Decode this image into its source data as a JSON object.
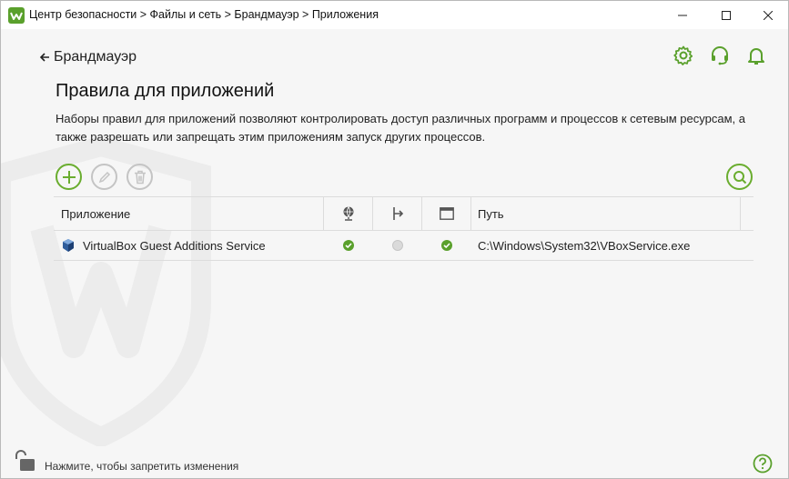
{
  "window": {
    "title": "Центр безопасности > Файлы и сеть > Брандмауэр > Приложения",
    "controls": [
      "minimize",
      "maximize",
      "close"
    ]
  },
  "header": {
    "back_label": "Брандмауэр",
    "icons": [
      "gear-icon",
      "headset-icon",
      "bell-icon"
    ]
  },
  "main": {
    "title": "Правила для приложений",
    "description": "Наборы правил для приложений позволяют контролировать доступ различных программ и процессов к сетевым ресурсам, а также разрешать или запрещать этим приложениям запуск других процессов."
  },
  "toolbar": {
    "buttons": [
      "plus-icon",
      "pencil-icon",
      "trash-icon",
      "search-icon"
    ]
  },
  "table": {
    "columns": {
      "application": "Приложение",
      "network_icon": "globe-network-icon",
      "process_icon": "process-launch-icon",
      "window_icon": "window-icon",
      "path": "Путь"
    },
    "rows": [
      {
        "name": "VirtualBox Guest Additions Service",
        "icon": "virtualbox-icon",
        "network": "allowed",
        "process": "not-set",
        "window": "allowed",
        "path": "C:\\Windows\\System32\\VBoxService.exe"
      }
    ]
  },
  "footer": {
    "lock_text": "Нажмите, чтобы запретить изменения"
  },
  "colors": {
    "accent": "#6aad2f",
    "status_on": "#5aa02c",
    "disabled": "#c4c4c4"
  }
}
